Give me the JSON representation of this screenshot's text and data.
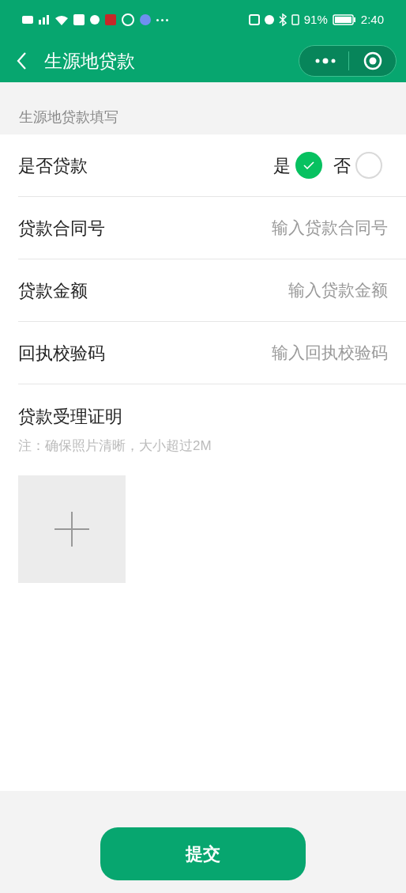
{
  "status_bar": {
    "battery": "91%",
    "time": "2:40"
  },
  "nav": {
    "title": "生源地贷款"
  },
  "section_title": "生源地贷款填写",
  "loan_choice": {
    "label": "是否贷款",
    "options": [
      {
        "label": "是",
        "selected": true
      },
      {
        "label": "否",
        "selected": false
      }
    ]
  },
  "fields": [
    {
      "label": "贷款合同号",
      "placeholder": "输入贷款合同号"
    },
    {
      "label": "贷款金额",
      "placeholder": "输入贷款金额"
    },
    {
      "label": "回执校验码",
      "placeholder": "输入回执校验码"
    }
  ],
  "upload": {
    "label": "贷款受理证明",
    "note": "注：确保照片清晰，大小超过2M"
  },
  "submit": "提交"
}
